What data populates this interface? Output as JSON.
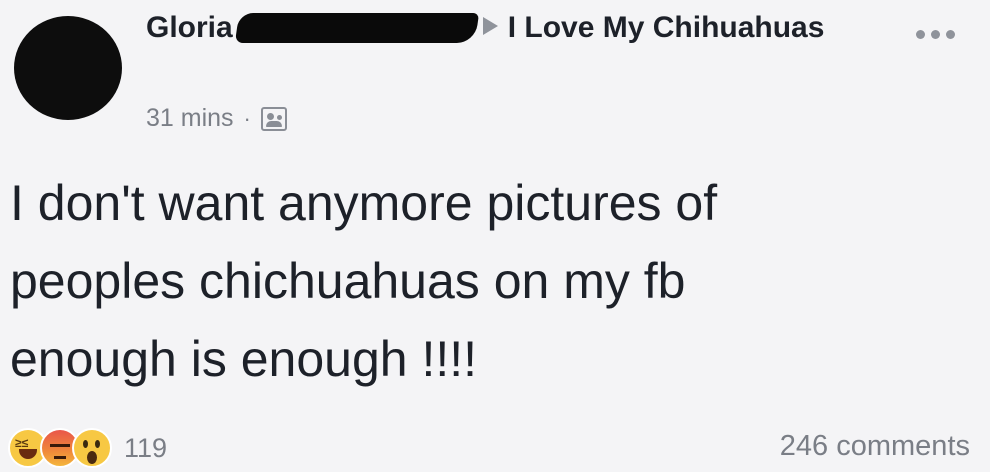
{
  "post": {
    "author": "Gloria",
    "group": "I Love My Chihuahuas",
    "time": "31 mins",
    "separator": "·",
    "privacy_icon": "group-icon",
    "more_icon": "ellipsis-icon",
    "text_lines": [
      "I don't want anymore pictures of",
      "peoples chichuahuas on my fb",
      "enough is enough !!!!"
    ]
  },
  "footer": {
    "reactions": [
      "haha",
      "angry",
      "wow"
    ],
    "reaction_count": "119",
    "comments": "246 comments"
  },
  "colors": {
    "background": "#f4f4f6",
    "text": "#1d2129",
    "meta": "#7a7e86"
  }
}
